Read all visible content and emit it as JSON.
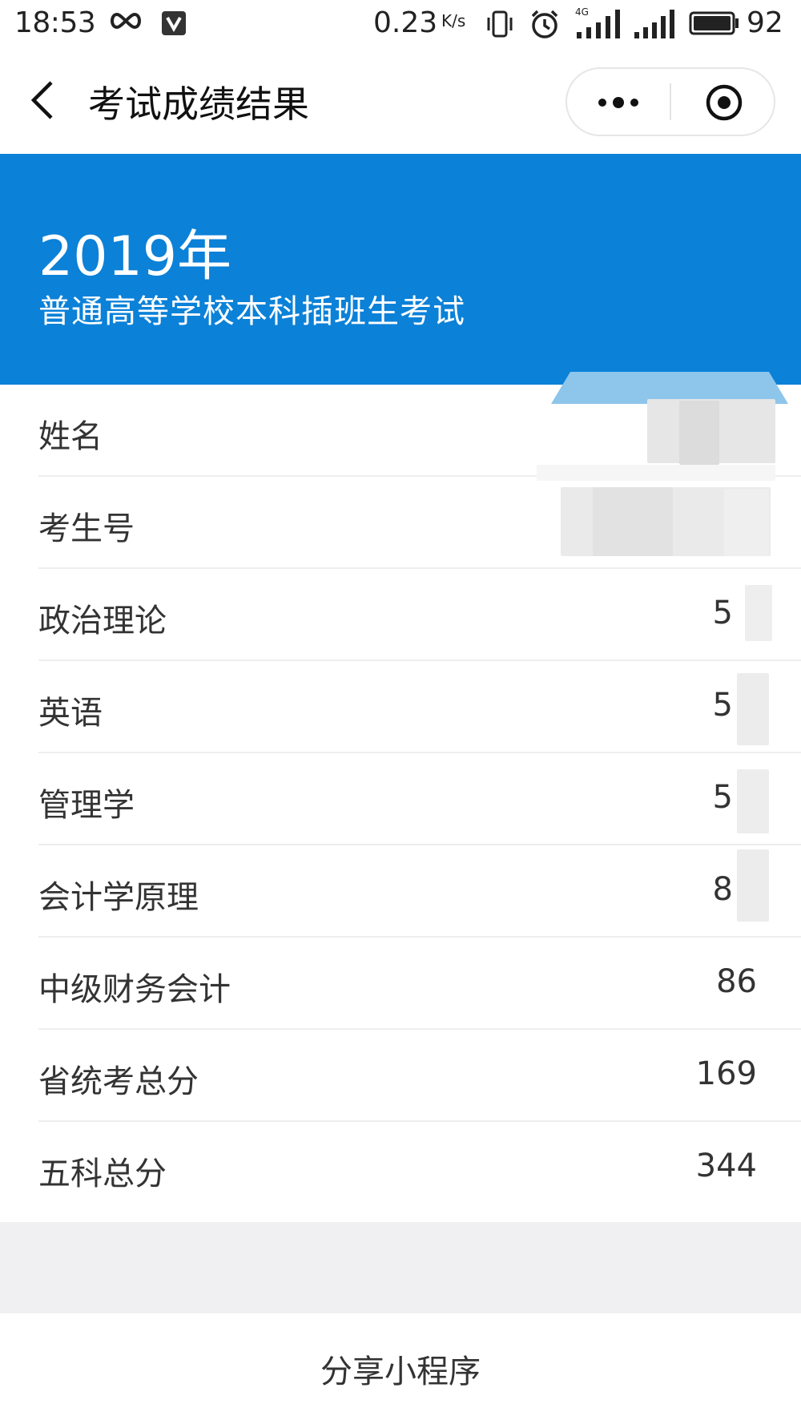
{
  "status_bar": {
    "time": "18:53",
    "speed": "0.23",
    "speed_unit": "K/s",
    "network": "4G",
    "battery": "92",
    "icons": [
      "infinity-icon",
      "shield-check-icon",
      "vibrate-icon",
      "alarm-icon",
      "signal-4g-icon",
      "signal-icon",
      "battery-icon"
    ]
  },
  "nav": {
    "title": "考试成绩结果",
    "back_icon": "chevron-left-icon",
    "more_icon": "more-dots-icon",
    "close_icon": "target-close-icon"
  },
  "banner": {
    "year": "2019年",
    "subtitle": "普通高等学校本科插班生考试",
    "color": "#0b81d8"
  },
  "scores": [
    {
      "label": "姓名",
      "value": ""
    },
    {
      "label": "考生号",
      "value": ""
    },
    {
      "label": "政治理论",
      "value": "5"
    },
    {
      "label": "英语",
      "value": "5"
    },
    {
      "label": "管理学",
      "value": "5"
    },
    {
      "label": "会计学原理",
      "value": "8"
    },
    {
      "label": "中级财务会计",
      "value": "86"
    },
    {
      "label": "省统考总分",
      "value": "169"
    },
    {
      "label": "五科总分",
      "value": "344"
    }
  ],
  "share": {
    "label": "分享小程序"
  }
}
